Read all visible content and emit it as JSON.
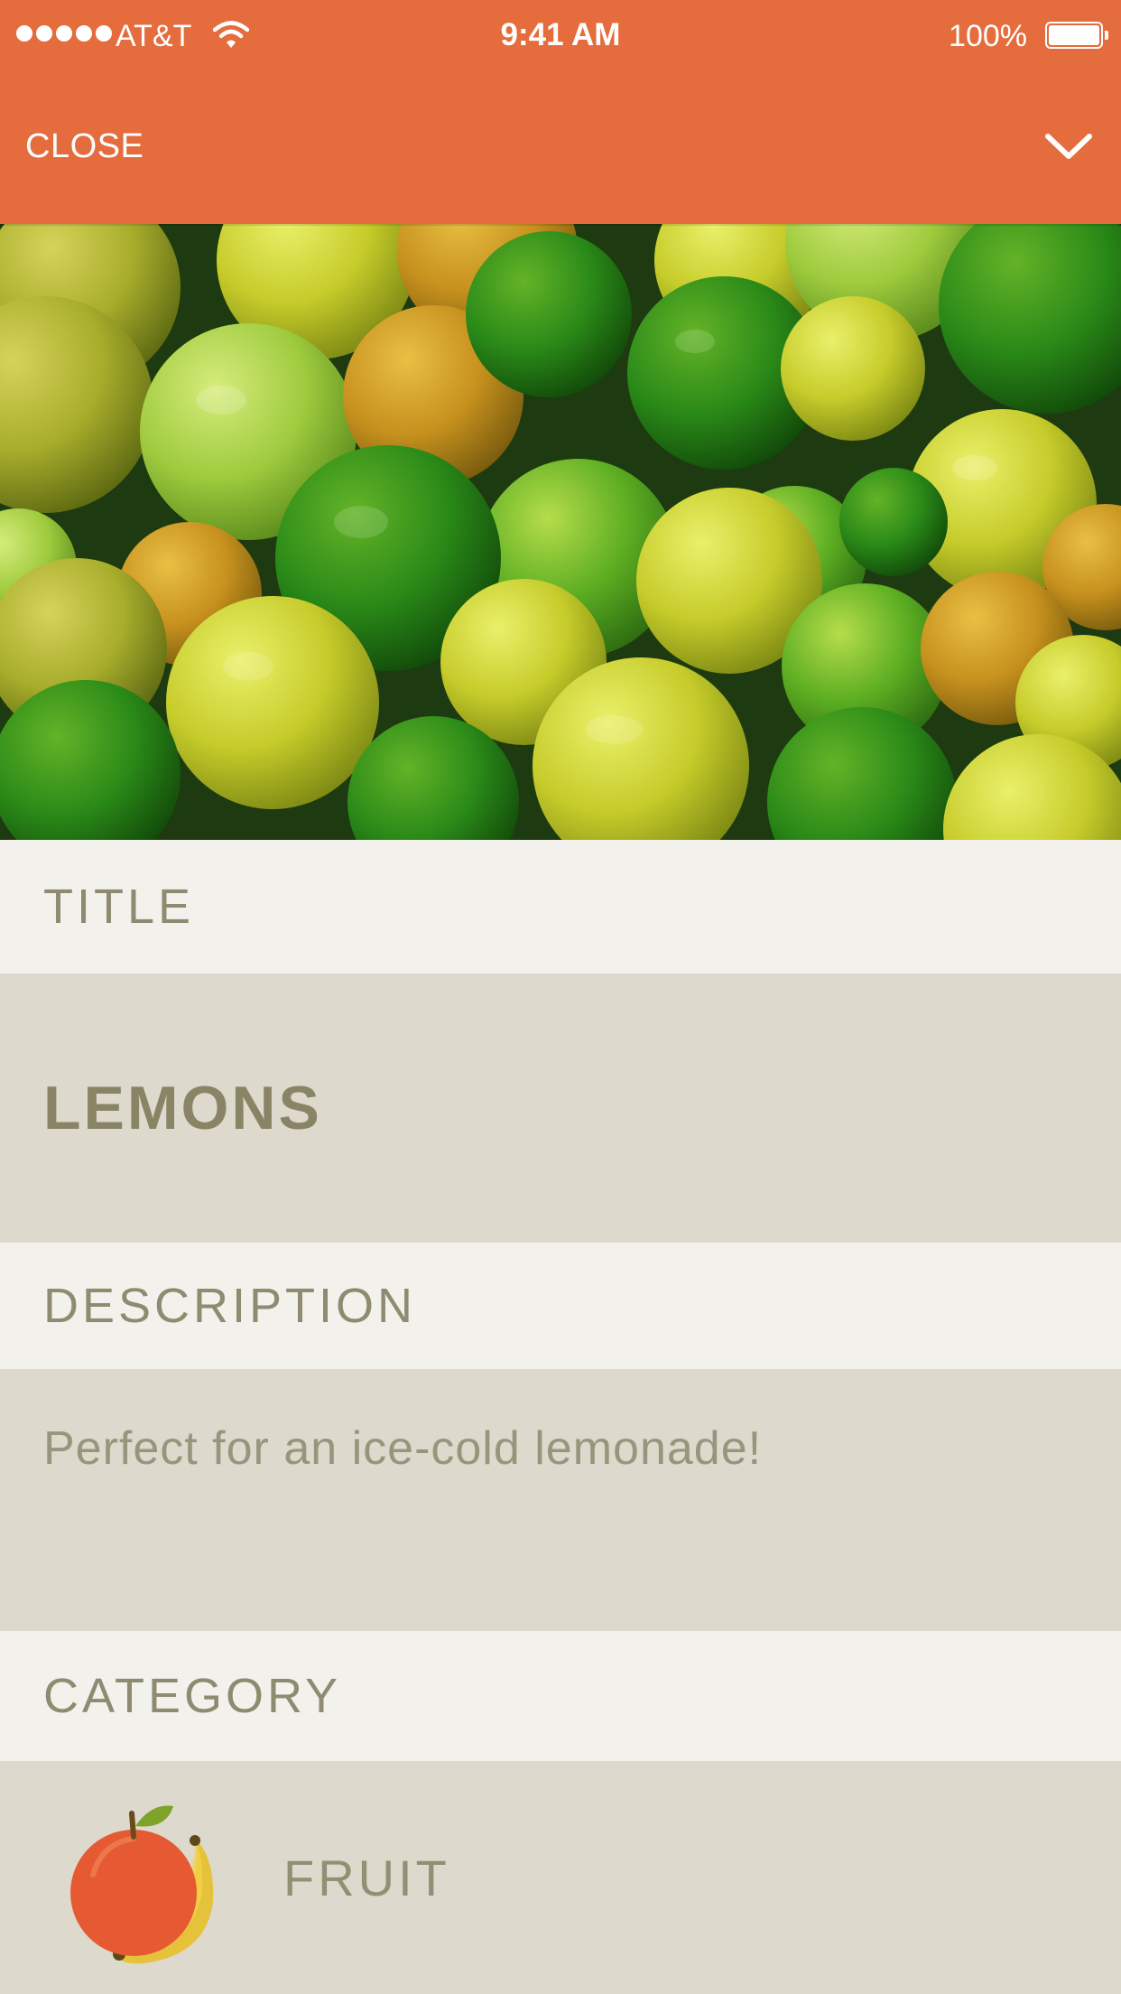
{
  "status_bar": {
    "carrier": "AT&T",
    "time": "9:41 AM",
    "battery": "100%",
    "signal_icon": "signal-dots-icon",
    "wifi_icon": "wifi-icon",
    "battery_icon": "battery-icon"
  },
  "nav": {
    "close_label": "CLOSE",
    "collapse_icon": "chevron-down-icon"
  },
  "hero": {
    "image_subject": "pile of green and yellow limes"
  },
  "fields": {
    "title_label": "TITLE",
    "title_value": "LEMONS",
    "description_label": "DESCRIPTION",
    "description_value": "Perfect for an ice-cold lemonade!",
    "category_label": "CATEGORY",
    "category_value": "FRUIT",
    "category_icon": "fruit-apple-banana-icon"
  },
  "colors": {
    "accent": "#e56c3d",
    "label_bg": "#f2f1ec",
    "value_bg": "#ddd9cc",
    "text": "#8f8b71"
  }
}
